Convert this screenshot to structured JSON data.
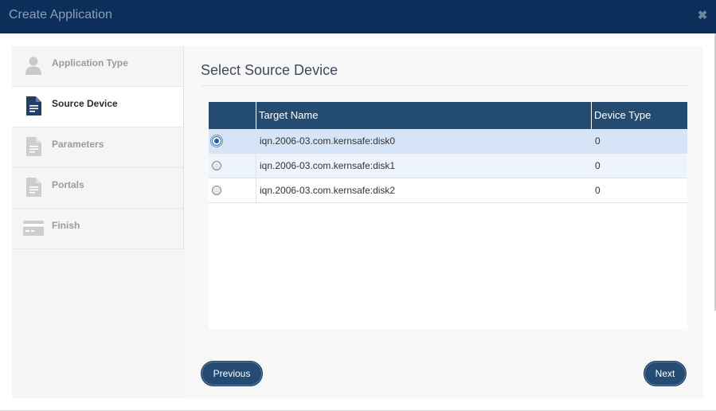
{
  "window": {
    "title": "Create Application",
    "close_icon": "close-icon"
  },
  "sidebar": {
    "steps": [
      {
        "label": "Application Type",
        "icon": "user-icon",
        "active": false
      },
      {
        "label": "Source Device",
        "icon": "document-icon",
        "active": true
      },
      {
        "label": "Parameters",
        "icon": "document-icon",
        "active": false
      },
      {
        "label": "Portals",
        "icon": "document-icon",
        "active": false
      },
      {
        "label": "Finish",
        "icon": "card-icon",
        "active": false
      }
    ]
  },
  "main": {
    "heading": "Select Source Device",
    "table": {
      "columns": [
        "Target Name",
        "Device Type"
      ],
      "rows": [
        {
          "target_name": "iqn.2006-03.com.kernsafe:disk0",
          "device_type": "0",
          "selected": true
        },
        {
          "target_name": "iqn.2006-03.com.kernsafe:disk1",
          "device_type": "0",
          "selected": false
        },
        {
          "target_name": "iqn.2006-03.com.kernsafe:disk2",
          "device_type": "0",
          "selected": false
        }
      ]
    }
  },
  "footer": {
    "previous_label": "Previous",
    "next_label": "Next"
  },
  "colors": {
    "titlebar": "#0b2f5a",
    "table_header": "#244c73",
    "button": "#244c73",
    "selected_row": "#d5e5f7"
  }
}
